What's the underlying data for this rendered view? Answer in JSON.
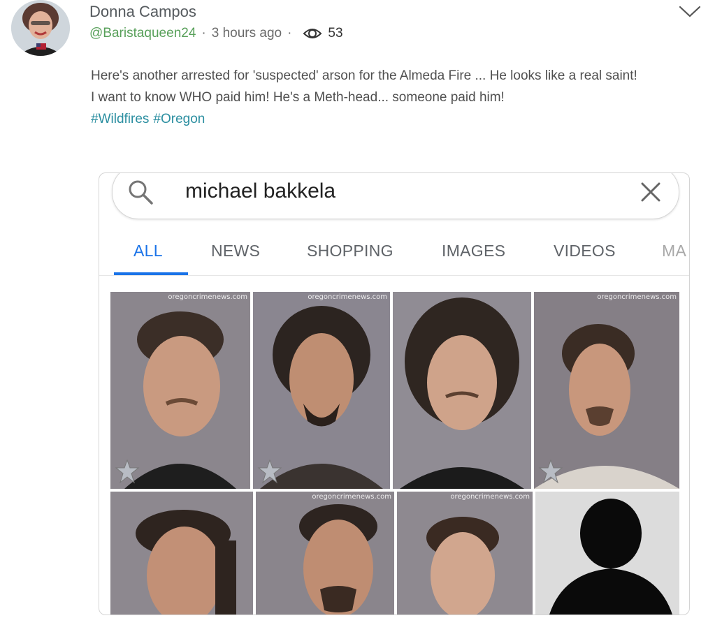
{
  "post": {
    "author_name": "Donna Campos",
    "handle": "@Baristaqueen24",
    "time": "3 hours ago",
    "views": "53",
    "text_line1": "Here's another arrested for 'suspected' arson for the Almeda Fire ... He looks like a real saint!",
    "text_line2": "I want to know WHO paid him! He's a Meth-head... someone paid him!",
    "hashtags": [
      "#Wildfires",
      "#Oregon"
    ]
  },
  "screenshot": {
    "query": "michael bakkela",
    "tabs": [
      "ALL",
      "NEWS",
      "SHOPPING",
      "IMAGES",
      "VIDEOS",
      "MA"
    ],
    "active_tab": "ALL",
    "watermark": "oregoncrimenews.com",
    "results": [
      {
        "name": "mugshot-1"
      },
      {
        "name": "mugshot-2"
      },
      {
        "name": "mugshot-3"
      },
      {
        "name": "mugshot-4"
      },
      {
        "name": "mugshot-5"
      },
      {
        "name": "mugshot-6"
      },
      {
        "name": "mugshot-7"
      },
      {
        "name": "silhouette-placeholder"
      }
    ]
  },
  "colors": {
    "handle": "#58a05a",
    "hashtag": "#2a8ea0",
    "active_tab": "#1a73e8"
  },
  "icons": [
    "avatar",
    "chevron-down-icon",
    "eye-icon",
    "search-icon",
    "close-icon",
    "sheriff-badge-icon",
    "person-silhouette-icon"
  ]
}
